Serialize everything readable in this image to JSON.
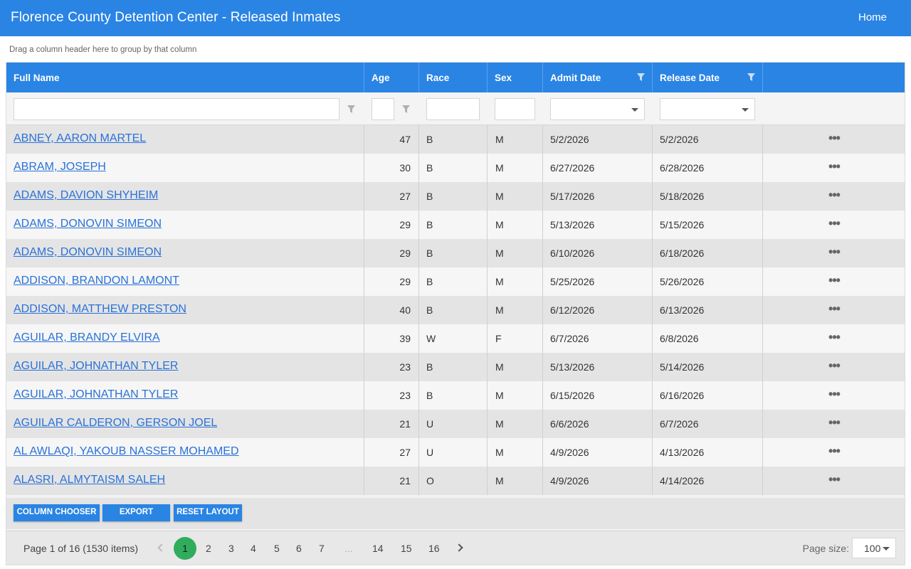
{
  "app": {
    "title": "Florence County Detention Center - Released Inmates",
    "home_label": "Home"
  },
  "grid": {
    "group_hint": "Drag a column header here to group by that column",
    "columns": [
      "Full Name",
      "Age",
      "Race",
      "Sex",
      "Admit Date",
      "Release Date"
    ],
    "rows": [
      {
        "name": "ABNEY, AARON MARTEL",
        "age": "47",
        "race": "B",
        "sex": "M",
        "admit": "5/2/2026",
        "release": "5/2/2026"
      },
      {
        "name": "ABRAM, JOSEPH",
        "age": "30",
        "race": "B",
        "sex": "M",
        "admit": "6/27/2026",
        "release": "6/28/2026"
      },
      {
        "name": "ADAMS, DAVION SHYHEIM",
        "age": "27",
        "race": "B",
        "sex": "M",
        "admit": "5/17/2026",
        "release": "5/18/2026"
      },
      {
        "name": "ADAMS, DONOVIN SIMEON",
        "age": "29",
        "race": "B",
        "sex": "M",
        "admit": "5/13/2026",
        "release": "5/15/2026"
      },
      {
        "name": "ADAMS, DONOVIN SIMEON",
        "age": "29",
        "race": "B",
        "sex": "M",
        "admit": "6/10/2026",
        "release": "6/18/2026"
      },
      {
        "name": "ADDISON, BRANDON LAMONT",
        "age": "29",
        "race": "B",
        "sex": "M",
        "admit": "5/25/2026",
        "release": "5/26/2026"
      },
      {
        "name": "ADDISON, MATTHEW PRESTON",
        "age": "40",
        "race": "B",
        "sex": "M",
        "admit": "6/12/2026",
        "release": "6/13/2026"
      },
      {
        "name": "AGUILAR, BRANDY ELVIRA",
        "age": "39",
        "race": "W",
        "sex": "F",
        "admit": "6/7/2026",
        "release": "6/8/2026"
      },
      {
        "name": "AGUILAR, JOHNATHAN TYLER",
        "age": "23",
        "race": "B",
        "sex": "M",
        "admit": "5/13/2026",
        "release": "5/14/2026"
      },
      {
        "name": "AGUILAR, JOHNATHAN TYLER",
        "age": "23",
        "race": "B",
        "sex": "M",
        "admit": "6/15/2026",
        "release": "6/16/2026"
      },
      {
        "name": "AGUILAR CALDERON, GERSON JOEL",
        "age": "21",
        "race": "U",
        "sex": "M",
        "admit": "6/6/2026",
        "release": "6/7/2026"
      },
      {
        "name": "AL AWLAQI, YAKOUB NASSER MOHAMED",
        "age": "27",
        "race": "U",
        "sex": "M",
        "admit": "4/9/2026",
        "release": "4/13/2026"
      },
      {
        "name": "ALASRI, ALMYTAISM SALEH",
        "age": "21",
        "race": "O",
        "sex": "M",
        "admit": "4/9/2026",
        "release": "4/14/2026"
      }
    ],
    "more_glyph": "•••"
  },
  "toolbar": {
    "column_chooser": "COLUMN CHOOSER",
    "export": "EXPORT",
    "reset_layout": "RESET LAYOUT"
  },
  "pager": {
    "info": "Page 1 of 16 (1530 items)",
    "pages": [
      "1",
      "2",
      "3",
      "4",
      "5",
      "6",
      "7",
      "...",
      "14",
      "15",
      "16"
    ],
    "page_size_label": "Page size:",
    "page_size": "100"
  },
  "colors": {
    "header": "#2a84e4",
    "active_page": "#2fad5d",
    "link": "#2a72d8"
  }
}
